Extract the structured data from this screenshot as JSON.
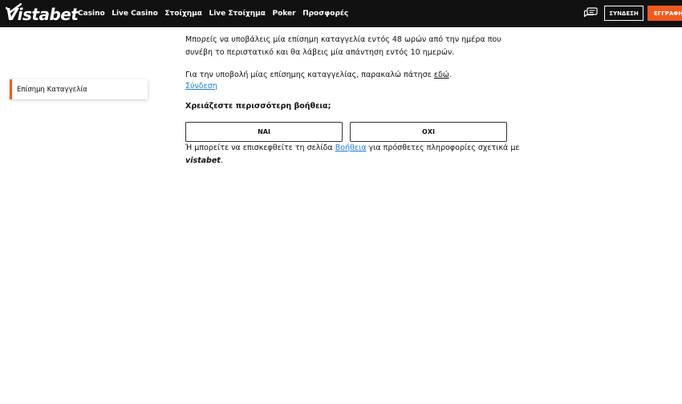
{
  "header": {
    "logo_text": "Vistabet",
    "nav": [
      "Casino",
      "Live Casino",
      "Στοίχημα",
      "Live Στοίχημα",
      "Poker",
      "Προσφορές"
    ],
    "chat_icon": "chat-bubbles-icon",
    "login_label": "ΣΥΝΔΕΣΗ",
    "register_label": "ΕΓΓΡΑΦΗ",
    "accent_color": "#f25a1d",
    "background_color": "#111111"
  },
  "sidebar": {
    "items": [
      {
        "label": "Επίσημη Καταγγελία"
      }
    ]
  },
  "main": {
    "paragraph1": "Μπορείς να υποβάλεις μία επίσημη καταγγελία εντός 48 ωρών από την ημέρα που συνέβη το περιστατικό και θα λάβεις μία απάντηση εντός 10 ημερών.",
    "paragraph2_text": "Για την υποβολή μίας επίσημης καταγγελίας, παρακαλώ πάτησε ",
    "paragraph2_link": "εδώ",
    "paragraph2_end": ".",
    "login_link": "Σύνδεση",
    "help_question": "Χρειάζεστε περισσότερη βοήθεια;",
    "yes_label": "ΝΑΙ",
    "no_label": "ΟΧΙ",
    "paragraph3_text": "Ή μπορείτε να επισκεφθείτε τη σελίδα ",
    "paragraph3_link": "Βοήθεια",
    "paragraph3_mid": " για πρόσθετες πληροφορίες σχετικά με ",
    "paragraph3_brand": "vistabet",
    "paragraph3_end": "."
  }
}
